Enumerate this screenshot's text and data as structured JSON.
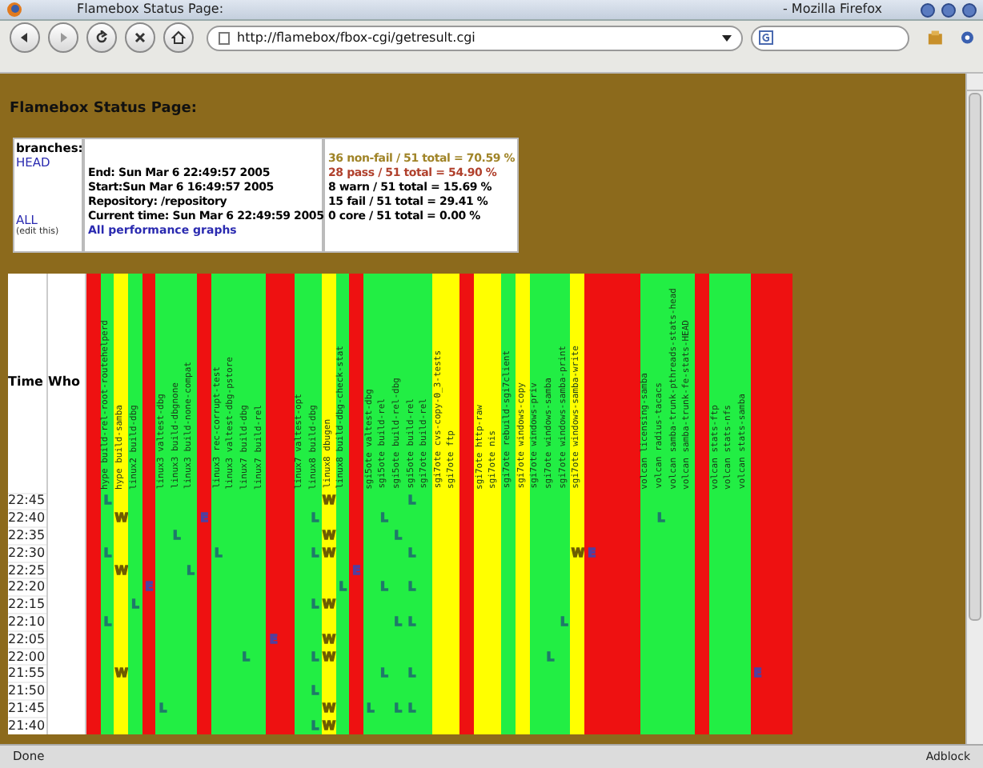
{
  "window": {
    "title": "Flamebox Status Page:",
    "app": "- Mozilla Firefox"
  },
  "toolbar": {
    "url": "http://flamebox/fbox-cgi/getresult.cgi"
  },
  "page": {
    "heading": "Flamebox Status Page:",
    "branches": {
      "title": "branches:",
      "links": [
        "HEAD",
        "ALL"
      ],
      "note": "(edit this)"
    },
    "info": [
      "End: Sun Mar 6 22:49:57 2005",
      "Start:Sun Mar 6 16:49:57 2005",
      "Repository: /repository",
      "Current time: Sun Mar 6 22:49:59 2005"
    ],
    "graphs_link": "All performance graphs",
    "stats": [
      {
        "text": "36 non-fail / 51 total = 70.59 %",
        "color": "#a08428"
      },
      {
        "text": "28 pass / 51 total = 54.90 %",
        "color": "#b0402c"
      },
      {
        "text": "8 warn / 51 total = 15.69 %",
        "color": "#000000"
      },
      {
        "text": "15 fail / 51 total = 29.41 %",
        "color": "#000000"
      },
      {
        "text": "0 core / 51 total = 0.00 %",
        "color": "#000000"
      }
    ]
  },
  "grid": {
    "time_header": "Time",
    "who_header": "Who",
    "times": [
      "22:45",
      "22:40",
      "22:35",
      "22:30",
      "22:25",
      "22:20",
      "22:15",
      "22:10",
      "22:05",
      "22:00",
      "21:55",
      "21:50",
      "21:45",
      "21:40"
    ],
    "columns": [
      {
        "color": "#ee1111",
        "cells": [
          null,
          null,
          null,
          null,
          null,
          null,
          null,
          null,
          null,
          null,
          null,
          null,
          null,
          null
        ]
      },
      {
        "label": "hype build-rel-root-routehelperd",
        "color": "#22ee44",
        "cells": [
          {
            "text": "L",
            "kind": "log"
          },
          null,
          null,
          {
            "text": "L",
            "kind": "log"
          },
          null,
          null,
          null,
          {
            "text": "L",
            "kind": "log"
          },
          null,
          null,
          null,
          null,
          null,
          null
        ]
      },
      {
        "label": "hype build-samba",
        "color": "#ffff00",
        "cells": [
          null,
          {
            "text": "W",
            "kind": "warning"
          },
          null,
          null,
          {
            "text": "W",
            "kind": "warning"
          },
          null,
          null,
          null,
          null,
          null,
          {
            "text": "W",
            "kind": "warning"
          },
          null,
          null,
          null
        ]
      },
      {
        "label": "linux2 build-dbg",
        "color": "#22ee44",
        "cells": [
          null,
          null,
          null,
          null,
          null,
          null,
          {
            "text": "L",
            "kind": "log"
          },
          null,
          null,
          null,
          null,
          null,
          null,
          null
        ]
      },
      {
        "color": "#ee1111",
        "cells": [
          null,
          null,
          null,
          null,
          null,
          {
            "text": "E",
            "kind": "error"
          },
          null,
          null,
          null,
          null,
          null,
          null,
          null,
          null
        ]
      },
      {
        "label": "linux3 valtest-dbg",
        "color": "#22ee44",
        "cells": [
          null,
          null,
          null,
          null,
          null,
          null,
          null,
          null,
          null,
          null,
          null,
          null,
          {
            "text": "L",
            "kind": "log"
          },
          null
        ]
      },
      {
        "label": "linux3 build-dbgnone",
        "color": "#22ee44",
        "cells": [
          null,
          null,
          {
            "text": "L",
            "kind": "log"
          },
          null,
          null,
          null,
          null,
          null,
          null,
          null,
          null,
          null,
          null,
          null
        ]
      },
      {
        "label": "linux3 build-none-compat",
        "color": "#22ee44",
        "cells": [
          null,
          null,
          null,
          null,
          {
            "text": "L",
            "kind": "log"
          },
          null,
          null,
          null,
          null,
          null,
          null,
          null,
          null,
          null
        ]
      },
      {
        "color": "#ee1111",
        "cells": [
          null,
          {
            "text": "E",
            "kind": "error"
          },
          null,
          null,
          null,
          null,
          null,
          null,
          null,
          null,
          null,
          null,
          null,
          null
        ]
      },
      {
        "label": "linux3 rec-corrupt-test",
        "color": "#22ee44",
        "cells": [
          null,
          null,
          null,
          {
            "text": "L",
            "kind": "log"
          },
          null,
          null,
          null,
          null,
          null,
          null,
          null,
          null,
          null,
          null
        ]
      },
      {
        "label": "linux3 valtest-dbg-pstore",
        "color": "#22ee44",
        "cells": [
          null,
          null,
          null,
          null,
          null,
          null,
          null,
          null,
          null,
          null,
          null,
          null,
          null,
          null
        ]
      },
      {
        "label": "linux7 build-dbg",
        "color": "#22ee44",
        "cells": [
          null,
          null,
          null,
          null,
          null,
          null,
          null,
          null,
          null,
          {
            "text": "L",
            "kind": "log"
          },
          null,
          null,
          null,
          null
        ]
      },
      {
        "label": "linux7 build-rel",
        "color": "#22ee44",
        "cells": [
          null,
          null,
          null,
          null,
          null,
          null,
          null,
          null,
          null,
          null,
          null,
          null,
          null,
          null
        ]
      },
      {
        "color": "#ee1111",
        "cells": [
          null,
          null,
          null,
          null,
          null,
          null,
          null,
          null,
          {
            "text": "E",
            "kind": "error"
          },
          null,
          null,
          null,
          null,
          null
        ]
      },
      {
        "color": "#ee1111",
        "cells": [
          null,
          null,
          null,
          null,
          null,
          null,
          null,
          null,
          null,
          null,
          null,
          null,
          null,
          null
        ]
      },
      {
        "label": "linux7 valtest-opt",
        "color": "#22ee44",
        "cells": [
          null,
          null,
          null,
          null,
          null,
          null,
          null,
          null,
          null,
          null,
          null,
          null,
          null,
          null
        ]
      },
      {
        "label": "linux8 build-dbg",
        "color": "#22ee44",
        "cells": [
          null,
          {
            "text": "L",
            "kind": "log"
          },
          null,
          {
            "text": "L",
            "kind": "log"
          },
          null,
          null,
          {
            "text": "L",
            "kind": "log"
          },
          null,
          null,
          {
            "text": "L",
            "kind": "log"
          },
          null,
          {
            "text": "L",
            "kind": "log"
          },
          null,
          {
            "text": "L",
            "kind": "log"
          }
        ]
      },
      {
        "label": "linux8 dbugen",
        "color": "#ffff00",
        "cells": [
          {
            "text": "W",
            "kind": "warning"
          },
          null,
          {
            "text": "W",
            "kind": "warning"
          },
          {
            "text": "W",
            "kind": "warning"
          },
          null,
          null,
          {
            "text": "W",
            "kind": "warning"
          },
          null,
          {
            "text": "W",
            "kind": "warning"
          },
          {
            "text": "W",
            "kind": "warning"
          },
          null,
          null,
          {
            "text": "W",
            "kind": "warning"
          },
          {
            "text": "W",
            "kind": "warning"
          }
        ]
      },
      {
        "label": "linux8 build-dbg-check-stat",
        "color": "#22ee44",
        "cells": [
          null,
          null,
          null,
          null,
          null,
          {
            "text": "L",
            "kind": "log"
          },
          null,
          null,
          null,
          null,
          null,
          null,
          null,
          null
        ]
      },
      {
        "color": "#ee1111",
        "cells": [
          null,
          null,
          null,
          null,
          {
            "text": "E",
            "kind": "error"
          },
          null,
          null,
          null,
          null,
          null,
          null,
          null,
          null,
          null
        ]
      },
      {
        "label": "sgi5ote valtest-dbg",
        "color": "#22ee44",
        "cells": [
          null,
          null,
          null,
          null,
          null,
          null,
          null,
          null,
          null,
          null,
          null,
          null,
          {
            "text": "L",
            "kind": "log"
          },
          null
        ]
      },
      {
        "label": "sgi5ote build-rel",
        "color": "#22ee44",
        "cells": [
          null,
          {
            "text": "L",
            "kind": "log"
          },
          null,
          null,
          null,
          {
            "text": "L",
            "kind": "log"
          },
          null,
          null,
          null,
          null,
          {
            "text": "L",
            "kind": "log"
          },
          null,
          null,
          null
        ]
      },
      {
        "label": "sgi5ote build-rel-dbg",
        "color": "#22ee44",
        "cells": [
          null,
          null,
          {
            "text": "L",
            "kind": "log"
          },
          null,
          null,
          null,
          null,
          {
            "text": "L",
            "kind": "log"
          },
          null,
          null,
          null,
          null,
          {
            "text": "L",
            "kind": "log"
          },
          null
        ]
      },
      {
        "label": "sgi5ote build-rel",
        "color": "#22ee44",
        "cells": [
          {
            "text": "L",
            "kind": "log"
          },
          null,
          null,
          {
            "text": "L",
            "kind": "log"
          },
          null,
          {
            "text": "L",
            "kind": "log"
          },
          null,
          {
            "text": "L",
            "kind": "log"
          },
          null,
          null,
          {
            "text": "L",
            "kind": "log"
          },
          null,
          {
            "text": "L",
            "kind": "log"
          },
          null
        ]
      },
      {
        "label": "sgi7ote build-rel",
        "color": "#22ee44",
        "cells": [
          null,
          null,
          null,
          null,
          null,
          null,
          null,
          null,
          null,
          null,
          null,
          null,
          null,
          null
        ]
      },
      {
        "label": "sgi7ote cvs-copy-0_3-tests",
        "color": "#ffff00",
        "cells": [
          null,
          null,
          null,
          null,
          null,
          null,
          null,
          null,
          null,
          null,
          null,
          null,
          null,
          null
        ]
      },
      {
        "label": "sgi7ote ftp",
        "color": "#ffff00",
        "cells": [
          null,
          null,
          null,
          null,
          null,
          null,
          null,
          null,
          null,
          null,
          null,
          null,
          null,
          null
        ]
      },
      {
        "color": "#ee1111",
        "cells": [
          null,
          null,
          null,
          null,
          null,
          null,
          null,
          null,
          null,
          null,
          null,
          null,
          null,
          null
        ]
      },
      {
        "label": "sgi7ote http-raw",
        "color": "#ffff00",
        "cells": [
          null,
          null,
          null,
          null,
          null,
          null,
          null,
          null,
          null,
          null,
          null,
          null,
          null,
          null
        ]
      },
      {
        "label": "sgi7ote nis",
        "color": "#ffff00",
        "cells": [
          null,
          null,
          null,
          null,
          null,
          null,
          null,
          null,
          null,
          null,
          null,
          null,
          null,
          null
        ]
      },
      {
        "label": "sgi7ote rebuild-sgi7client",
        "color": "#22ee44",
        "cells": [
          null,
          null,
          null,
          null,
          null,
          null,
          null,
          null,
          null,
          null,
          null,
          null,
          null,
          null
        ]
      },
      {
        "label": "sgi7ote windows-copy",
        "color": "#ffff00",
        "cells": [
          null,
          null,
          null,
          null,
          null,
          null,
          null,
          null,
          null,
          null,
          null,
          null,
          null,
          null
        ]
      },
      {
        "label": "sgi7ote windows-priv",
        "color": "#22ee44",
        "cells": [
          null,
          null,
          null,
          null,
          null,
          null,
          null,
          null,
          null,
          null,
          null,
          null,
          null,
          null
        ]
      },
      {
        "label": "sgi7ote windows-samba",
        "color": "#22ee44",
        "cells": [
          null,
          null,
          null,
          null,
          null,
          null,
          null,
          null,
          null,
          {
            "text": "L",
            "kind": "log"
          },
          null,
          null,
          null,
          null
        ]
      },
      {
        "label": "sgi7ote windows-samba-print",
        "color": "#22ee44",
        "cells": [
          null,
          null,
          null,
          null,
          null,
          null,
          null,
          {
            "text": "L",
            "kind": "log"
          },
          null,
          null,
          null,
          null,
          null,
          null
        ]
      },
      {
        "label": "sgi7ote windows-samba-write",
        "color": "#ffff00",
        "cells": [
          null,
          null,
          null,
          {
            "text": "W",
            "kind": "warning"
          },
          null,
          null,
          null,
          null,
          null,
          null,
          null,
          null,
          null,
          null
        ]
      },
      {
        "color": "#ee1111",
        "cells": [
          null,
          null,
          null,
          {
            "text": "E",
            "kind": "error"
          },
          null,
          null,
          null,
          null,
          null,
          null,
          null,
          null,
          null,
          null
        ]
      },
      {
        "color": "#ee1111",
        "cells": [
          null,
          null,
          null,
          null,
          null,
          null,
          null,
          null,
          null,
          null,
          null,
          null,
          null,
          null
        ]
      },
      {
        "color": "#ee1111",
        "cells": [
          null,
          null,
          null,
          null,
          null,
          null,
          null,
          null,
          null,
          null,
          null,
          null,
          null,
          null
        ]
      },
      {
        "color": "#ee1111",
        "cells": [
          null,
          null,
          null,
          null,
          null,
          null,
          null,
          null,
          null,
          null,
          null,
          null,
          null,
          null
        ]
      },
      {
        "label": "volcan licensing-samba",
        "color": "#22ee44",
        "cells": [
          null,
          null,
          null,
          null,
          null,
          null,
          null,
          null,
          null,
          null,
          null,
          null,
          null,
          null
        ]
      },
      {
        "label": "volcan radius-tacacs",
        "color": "#22ee44",
        "cells": [
          null,
          {
            "text": "L",
            "kind": "log"
          },
          null,
          null,
          null,
          null,
          null,
          null,
          null,
          null,
          null,
          null,
          null,
          null
        ]
      },
      {
        "label": "volcan samba-trunk-pthreads-stats-head",
        "color": "#22ee44",
        "cells": [
          null,
          null,
          null,
          null,
          null,
          null,
          null,
          null,
          null,
          null,
          null,
          null,
          null,
          null
        ]
      },
      {
        "label": "volcan samba-trunk-fe-stats-HEAD",
        "color": "#22ee44",
        "cells": [
          null,
          null,
          null,
          null,
          null,
          null,
          null,
          null,
          null,
          null,
          null,
          null,
          null,
          null
        ]
      },
      {
        "color": "#ee1111",
        "cells": [
          null,
          null,
          null,
          null,
          null,
          null,
          null,
          null,
          null,
          null,
          null,
          null,
          null,
          null
        ]
      },
      {
        "label": "volcan stats-ftp",
        "color": "#22ee44",
        "cells": [
          null,
          null,
          null,
          null,
          null,
          null,
          null,
          null,
          null,
          null,
          null,
          null,
          null,
          null
        ]
      },
      {
        "label": "volcan stats-nfs",
        "color": "#22ee44",
        "cells": [
          null,
          null,
          null,
          null,
          null,
          null,
          null,
          null,
          null,
          null,
          null,
          null,
          null,
          null
        ]
      },
      {
        "label": "volcan stats-samba",
        "color": "#22ee44",
        "cells": [
          null,
          null,
          null,
          null,
          null,
          null,
          null,
          null,
          null,
          null,
          null,
          null,
          null,
          null
        ]
      },
      {
        "color": "#ee1111",
        "cells": [
          null,
          null,
          null,
          null,
          null,
          null,
          null,
          null,
          null,
          null,
          {
            "text": "E",
            "kind": "error"
          },
          null,
          null,
          null
        ]
      },
      {
        "color": "#ee1111",
        "cells": [
          null,
          null,
          null,
          null,
          null,
          null,
          null,
          null,
          null,
          null,
          null,
          null,
          null,
          null
        ]
      },
      {
        "color": "#ee1111",
        "cells": [
          null,
          null,
          null,
          null,
          null,
          null,
          null,
          null,
          null,
          null,
          null,
          null,
          null,
          null
        ]
      }
    ]
  },
  "status_bar": {
    "text": "Done",
    "right": "Adblock"
  }
}
